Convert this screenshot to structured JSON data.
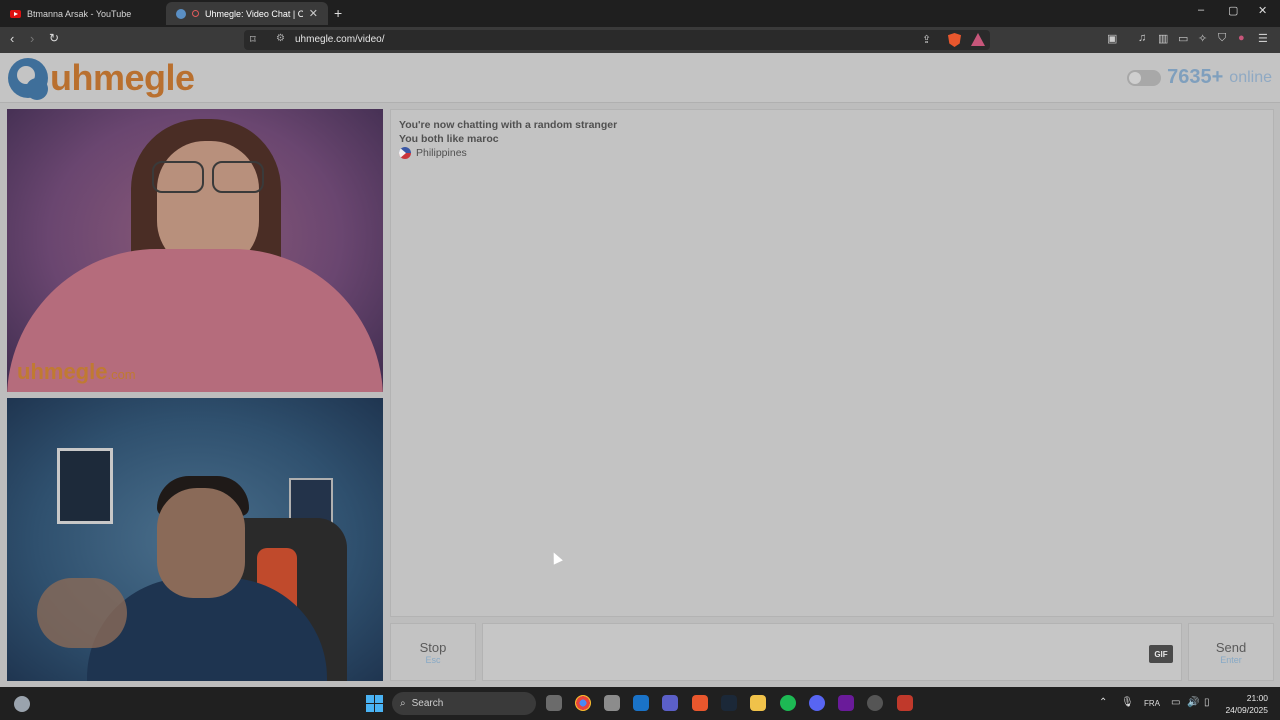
{
  "browser": {
    "tabs": [
      {
        "title": "Btmanna Arsak - YouTube",
        "favicon": "youtube-icon"
      },
      {
        "title": "Uhmegle: Video Chat | Omeg",
        "favicon": "uhmegle-icon",
        "active": true
      }
    ],
    "new_tab": "+",
    "url": "uhmegle.com/video/",
    "window_controls": [
      "–",
      "▢",
      "✕"
    ]
  },
  "site": {
    "logo_text": "uhmegle",
    "online_count": "7635+",
    "online_label": "online",
    "watermark_main": "uhmegle",
    "watermark_suffix": ".com"
  },
  "chat": {
    "messages": [
      "You're now chatting with a random stranger",
      "You both like maroc"
    ],
    "country": "Philippines"
  },
  "controls": {
    "stop_label": "Stop",
    "stop_hint": "Esc",
    "gif_label": "GIF",
    "send_label": "Send",
    "send_hint": "Enter"
  },
  "taskbar": {
    "search_label": "Search",
    "language": "FRA",
    "time": "21:00",
    "date": "24/09/2025"
  },
  "colors": {
    "logo_orange": "#b9702f",
    "logo_blue": "#3f6f9a",
    "online_blue": "#7f9fbd",
    "hint_blue": "#87a9c6"
  }
}
